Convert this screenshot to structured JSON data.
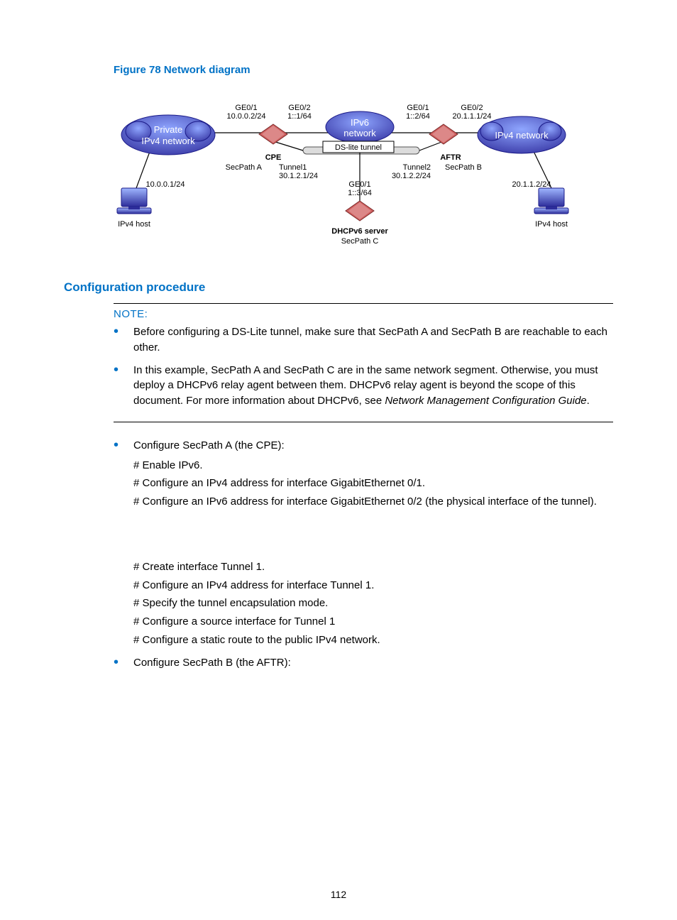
{
  "figure": {
    "title": "Figure 78 Network diagram",
    "clouds": {
      "left": {
        "line1": "Private",
        "line2": "IPv4 network"
      },
      "center": {
        "line1": "IPv6",
        "line2": "network"
      },
      "right": {
        "line1": "IPv4 network"
      }
    },
    "tunnel_label": "DS-lite tunnel",
    "hosts": {
      "left": {
        "ip": "10.0.0.1/24",
        "name": "IPv4 host"
      },
      "right": {
        "ip": "20.1.1.2/24",
        "name": "IPv4 host"
      }
    },
    "left_router": {
      "ge01": "GE0/1",
      "ge01_ip": "10.0.0.2/24",
      "ge02": "GE0/2",
      "ge02_ip": "1::1/64",
      "role": "CPE",
      "name": "SecPath A",
      "tunnel": "Tunnel1",
      "tunnel_ip": "30.1.2.1/24"
    },
    "right_router": {
      "ge01": "GE0/1",
      "ge01_ip": "1::2/64",
      "ge02": "GE0/2",
      "ge02_ip": "20.1.1.1/24",
      "role": "AFTR",
      "name": "SecPath B",
      "tunnel": "Tunnel2",
      "tunnel_ip": "30.1.2.2/24"
    },
    "bottom_router": {
      "ge01": "GE0/1",
      "ge01_ip": "1::3/64",
      "role": "DHCPv6 server",
      "name": "SecPath C"
    }
  },
  "section": {
    "config_procedure": "Configuration procedure"
  },
  "note": {
    "title": "NOTE:",
    "items": [
      "Before configuring a DS-Lite tunnel, make sure that SecPath A and SecPath B are reachable to each other.",
      "In this example, SecPath A and SecPath C are in the same network segment. Otherwise, you must deploy a DHCPv6 relay agent between them. DHCPv6 relay agent is beyond the scope of this document. For more information about DHCPv6, see Network Management Configuration Guide."
    ],
    "italic_tail": "Network Management Configuration Guide"
  },
  "steps": {
    "a_head": "Configure SecPath A (the CPE):",
    "a": [
      "# Enable IPv6.",
      "# Configure an IPv4 address for interface GigabitEthernet 0/1.",
      "# Configure an IPv6 address for interface GigabitEthernet 0/2 (the physical interface of the tunnel).",
      "# Create interface Tunnel 1.",
      "# Configure an IPv4 address for interface Tunnel 1.",
      "# Specify the tunnel encapsulation mode.",
      "# Configure a source interface for Tunnel 1",
      "# Configure a static route to the public IPv4 network."
    ],
    "b_head": "Configure SecPath B (the AFTR):"
  },
  "page_number": "112"
}
